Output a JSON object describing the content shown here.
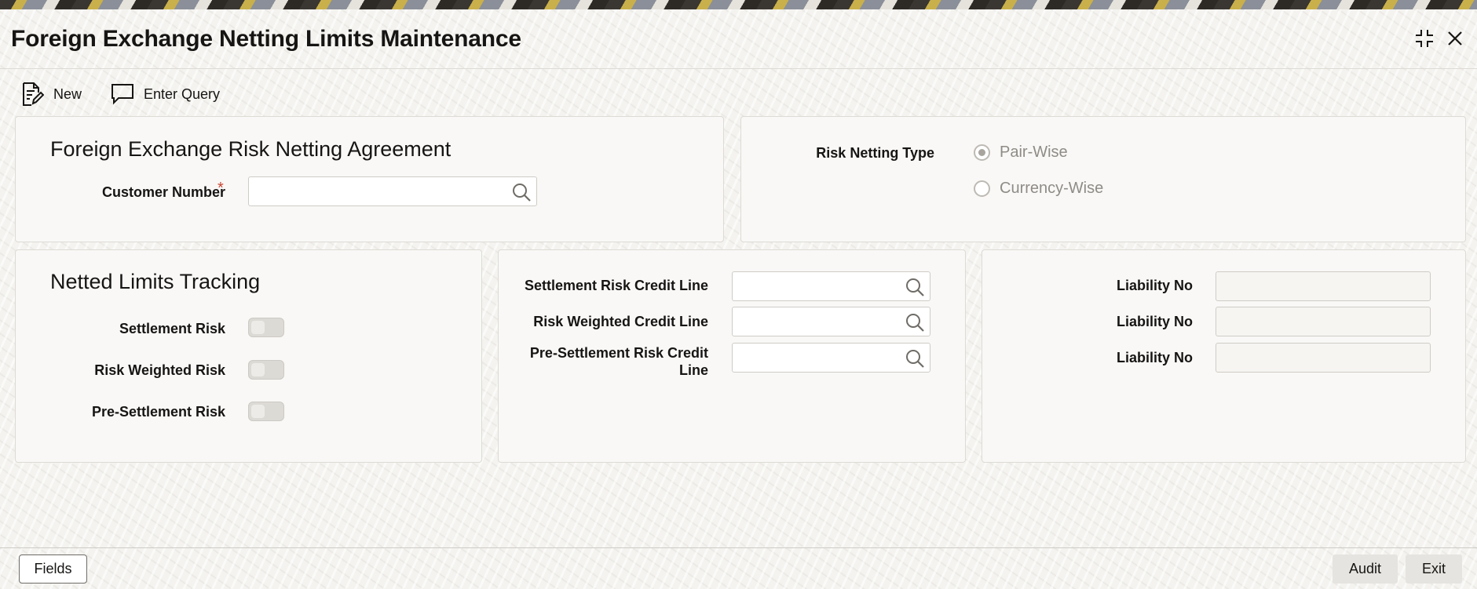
{
  "window": {
    "title": "Foreign Exchange Netting Limits Maintenance"
  },
  "toolbar": {
    "new_label": "New",
    "new_icon": "new-document-icon",
    "enter_query_label": "Enter Query",
    "enter_query_icon": "query-chat-icon"
  },
  "agreement": {
    "section_title": "Foreign Exchange Risk Netting Agreement",
    "customer_number_label": "Customer Number",
    "required_marker": "*",
    "customer_number_value": ""
  },
  "risk_netting": {
    "label": "Risk Netting Type",
    "options": [
      {
        "label": "Pair-Wise",
        "selected": true
      },
      {
        "label": "Currency-Wise",
        "selected": false
      }
    ]
  },
  "tracking": {
    "section_title": "Netted Limits Tracking",
    "toggles": [
      {
        "label": "Settlement Risk",
        "on": false
      },
      {
        "label": "Risk Weighted Risk",
        "on": false
      },
      {
        "label": "Pre-Settlement Risk",
        "on": false
      }
    ]
  },
  "credit_lines": [
    {
      "label": "Settlement Risk Credit Line",
      "value": ""
    },
    {
      "label": "Risk Weighted Credit Line",
      "value": ""
    },
    {
      "label": "Pre-Settlement Risk Credit Line",
      "value": ""
    }
  ],
  "liabilities": [
    {
      "label": "Liability No",
      "value": ""
    },
    {
      "label": "Liability No",
      "value": ""
    },
    {
      "label": "Liability No",
      "value": ""
    }
  ],
  "footer": {
    "fields_label": "Fields",
    "audit_label": "Audit",
    "exit_label": "Exit"
  },
  "colors": {
    "required": "#c74634",
    "panel_background": "#f9f8f6",
    "page_background": "#f4f3f0"
  }
}
